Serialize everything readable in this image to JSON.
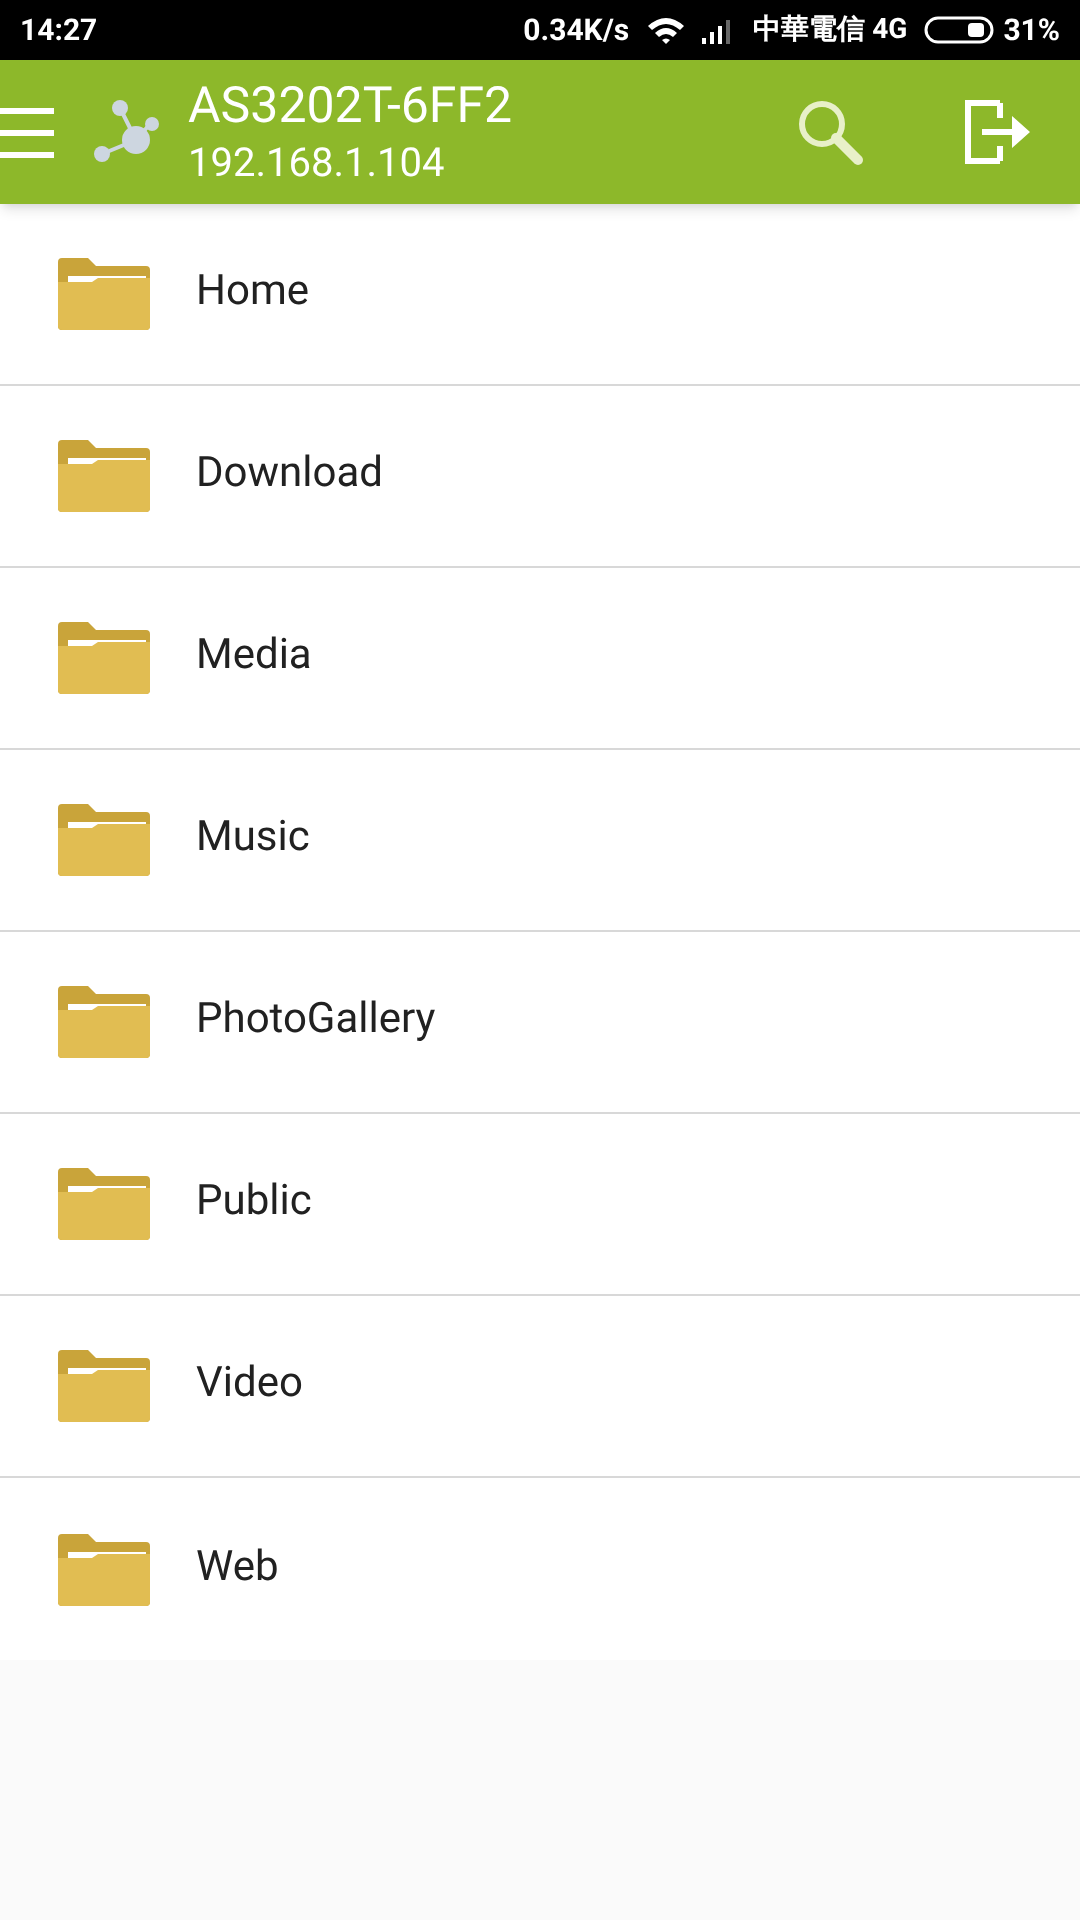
{
  "status_bar": {
    "time": "14:27",
    "speed": "0.34K/s",
    "carrier": "中華電信 4G",
    "battery": "31%"
  },
  "app_bar": {
    "title": "AS3202T-6FF2",
    "subtitle": "192.168.1.104"
  },
  "folders": [
    {
      "name": "Home"
    },
    {
      "name": "Download"
    },
    {
      "name": "Media"
    },
    {
      "name": "Music"
    },
    {
      "name": "PhotoGallery"
    },
    {
      "name": "Public"
    },
    {
      "name": "Video"
    },
    {
      "name": "Web"
    }
  ]
}
